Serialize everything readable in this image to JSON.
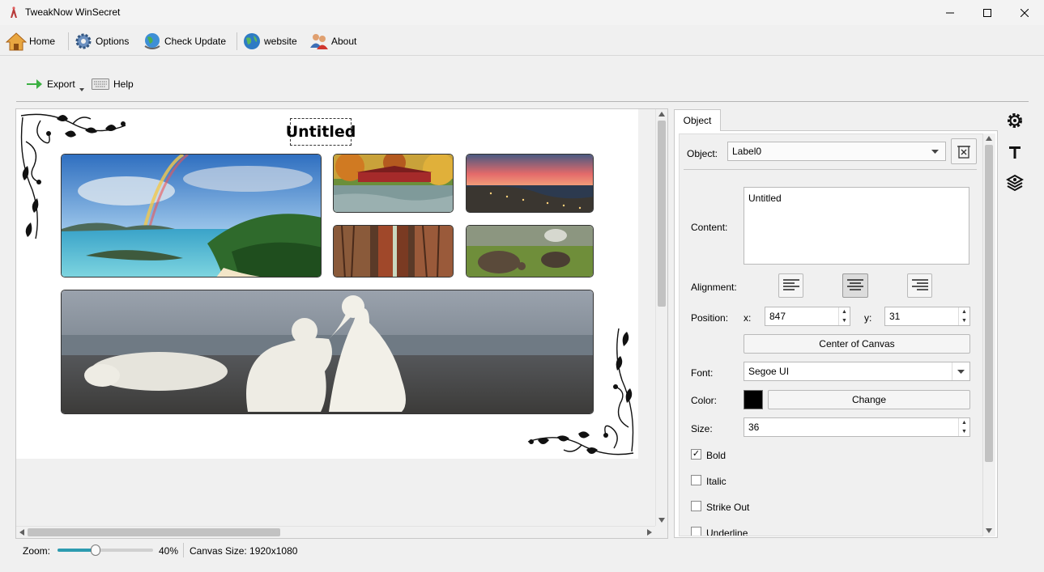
{
  "window": {
    "title": "TweakNow WinSecret"
  },
  "menu": {
    "home": "Home",
    "options": "Options",
    "check_update": "Check Update",
    "website": "website",
    "about": "About"
  },
  "toolbar": {
    "export": "Export",
    "help": "Help"
  },
  "canvas": {
    "label_text": "Untitled"
  },
  "panel": {
    "tab_label": "Object",
    "object_label": "Object:",
    "object_value": "Label0",
    "content_label": "Content:",
    "content_value": "Untitled",
    "alignment_label": "Alignment:",
    "position_label": "Position:",
    "x_label": "x:",
    "x_value": "847",
    "y_label": "y:",
    "y_value": "31",
    "center_button": "Center of Canvas",
    "font_label": "Font:",
    "font_value": "Segoe UI",
    "color_label": "Color:",
    "color_value": "#000000",
    "change_button": "Change",
    "size_label": "Size:",
    "size_value": "36",
    "bold_label": "Bold",
    "bold_checked": true,
    "italic_label": "Italic",
    "strikeout_label": "Strike Out",
    "underline_label": "Underline"
  },
  "status": {
    "zoom_label": "Zoom:",
    "zoom_value": "40%",
    "zoom_fraction": 0.4,
    "canvas_size": "Canvas Size: 1920x1080"
  },
  "icons": {
    "settings": "gear-icon",
    "text": "text-icon",
    "layers": "layers-icon"
  }
}
